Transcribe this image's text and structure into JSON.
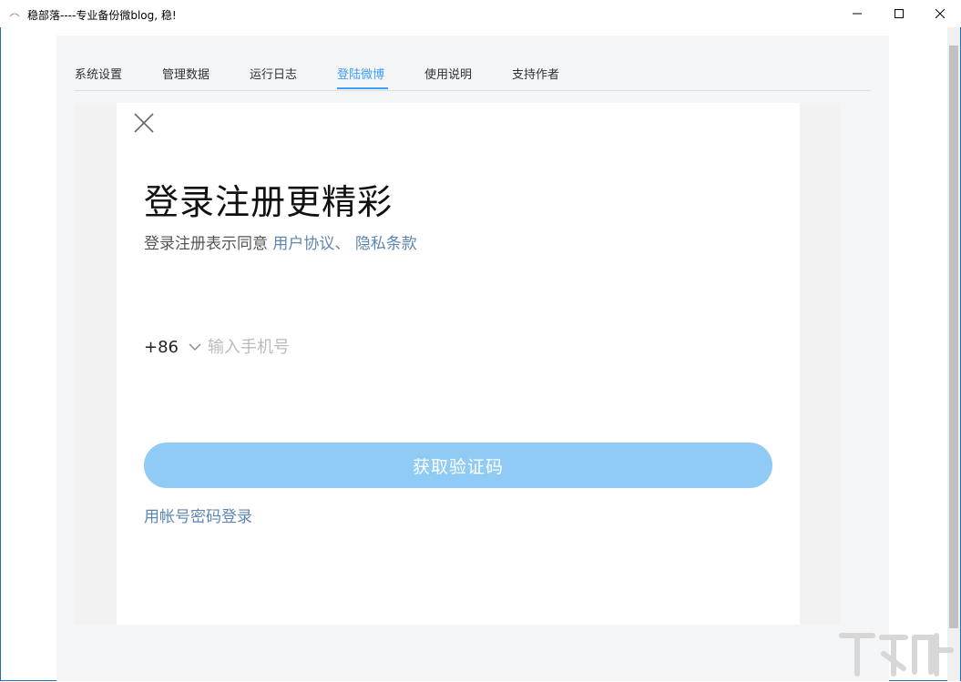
{
  "window": {
    "title": "稳部落----专业备份微blog, 稳!"
  },
  "tabs": [
    {
      "label": "系统设置",
      "active": false
    },
    {
      "label": "管理数据",
      "active": false
    },
    {
      "label": "运行日志",
      "active": false
    },
    {
      "label": "登陆微博",
      "active": true
    },
    {
      "label": "使用说明",
      "active": false
    },
    {
      "label": "支持作者",
      "active": false
    }
  ],
  "login": {
    "headline": "登录注册更精彩",
    "agreement_prefix": "登录注册表示同意 ",
    "user_agreement_link": "用户协议、",
    "privacy_link": "隐私条款",
    "country_code": "+86",
    "phone_placeholder": "输入手机号",
    "phone_value": "",
    "get_code_button": "获取验证码",
    "account_login_link": "用帐号密码登录"
  },
  "colors": {
    "accent": "#409eff",
    "link": "#5e86b0",
    "button": "#8fcbf5"
  },
  "icons": [
    "app-icon",
    "minimize-icon",
    "maximize-icon",
    "close-icon",
    "close-x-icon",
    "chevron-down-icon"
  ]
}
